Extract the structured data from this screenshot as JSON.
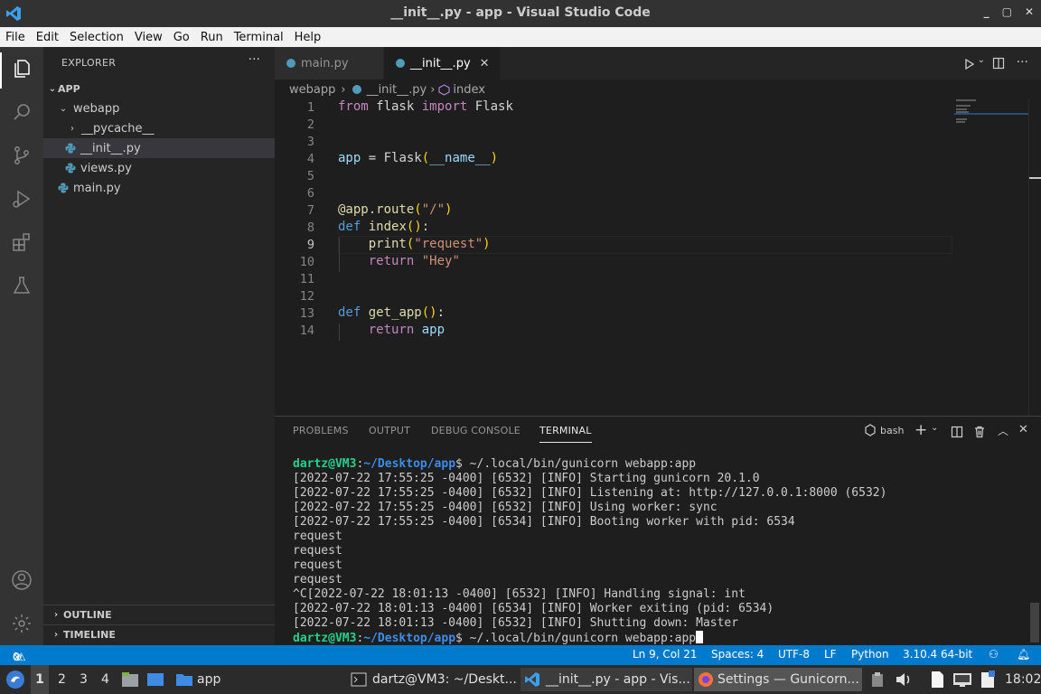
{
  "window": {
    "title": "__init__.py - app - Visual Studio Code",
    "controls": [
      "_",
      "▢",
      "✕"
    ]
  },
  "menu": [
    "File",
    "Edit",
    "Selection",
    "View",
    "Go",
    "Run",
    "Terminal",
    "Help"
  ],
  "sidebar": {
    "header": "EXPLORER",
    "more": "···",
    "tree": [
      {
        "label": "APP",
        "type": "folder-root"
      },
      {
        "label": "webapp",
        "type": "folder-open"
      },
      {
        "label": "__pycache__",
        "type": "folder-closed"
      },
      {
        "label": "__init__.py",
        "type": "py",
        "selected": true
      },
      {
        "label": "views.py",
        "type": "py"
      },
      {
        "label": "main.py",
        "type": "py"
      }
    ],
    "outline": "OUTLINE",
    "timeline": "TIMELINE"
  },
  "tabs": [
    {
      "label": "main.py",
      "active": false
    },
    {
      "label": "__init__.py",
      "active": true,
      "close": "✕"
    }
  ],
  "breadcrumb": {
    "folder": "webapp",
    "file": "__init__.py",
    "symbol": "index",
    "sep": "›"
  },
  "editor": {
    "line_numbers": [
      "1",
      "2",
      "3",
      "4",
      "5",
      "6",
      "7",
      "8",
      "9",
      "10",
      "11",
      "12",
      "13",
      "14"
    ],
    "current_line": 9
  },
  "panel": {
    "tabs": [
      "PROBLEMS",
      "OUTPUT",
      "DEBUG CONSOLE",
      "TERMINAL"
    ],
    "active": "TERMINAL",
    "shell": "bash"
  },
  "terminal": {
    "prompt_user": "dartz@VM3",
    "path1": "~/Desktop/app",
    "cmd1": "$ ~/.local/bin/gunicorn webapp:app",
    "lines": [
      "[2022-07-22 17:55:25 -0400] [6532] [INFO] Starting gunicorn 20.1.0",
      "[2022-07-22 17:55:25 -0400] [6532] [INFO] Listening at: http://127.0.0.1:8000 (6532)",
      "[2022-07-22 17:55:25 -0400] [6532] [INFO] Using worker: sync",
      "[2022-07-22 17:55:25 -0400] [6534] [INFO] Booting worker with pid: 6534",
      "request",
      "request",
      "request",
      "request",
      "^C[2022-07-22 18:01:13 -0400] [6532] [INFO] Handling signal: int",
      "[2022-07-22 18:01:13 -0400] [6534] [INFO] Worker exiting (pid: 6534)",
      "[2022-07-22 18:01:13 -0400] [6532] [INFO] Shutting down: Master"
    ],
    "path2": "~/Desktop/app",
    "cmd2": "$ ~/.local/bin/gunicorn webapp:app"
  },
  "status": {
    "errors": "0",
    "warnings": "0",
    "position": "Ln 9, Col 21",
    "spaces": "Spaces: 4",
    "encoding": "UTF-8",
    "eol": "LF",
    "language": "Python",
    "interpreter": "3.10.4 64-bit"
  },
  "taskbar": {
    "workspaces": [
      "1",
      "2",
      "3",
      "4"
    ],
    "folder": "app",
    "windows": [
      "dartz@VM3: ~/Deskt...",
      "__init__.py - app - Vis...",
      "Settings — Gunicorn..."
    ],
    "clock": "18:02"
  },
  "colors": {
    "accent": "#007acc",
    "activity": "#333333",
    "sidebar": "#252526",
    "editor": "#1e1e1e"
  }
}
